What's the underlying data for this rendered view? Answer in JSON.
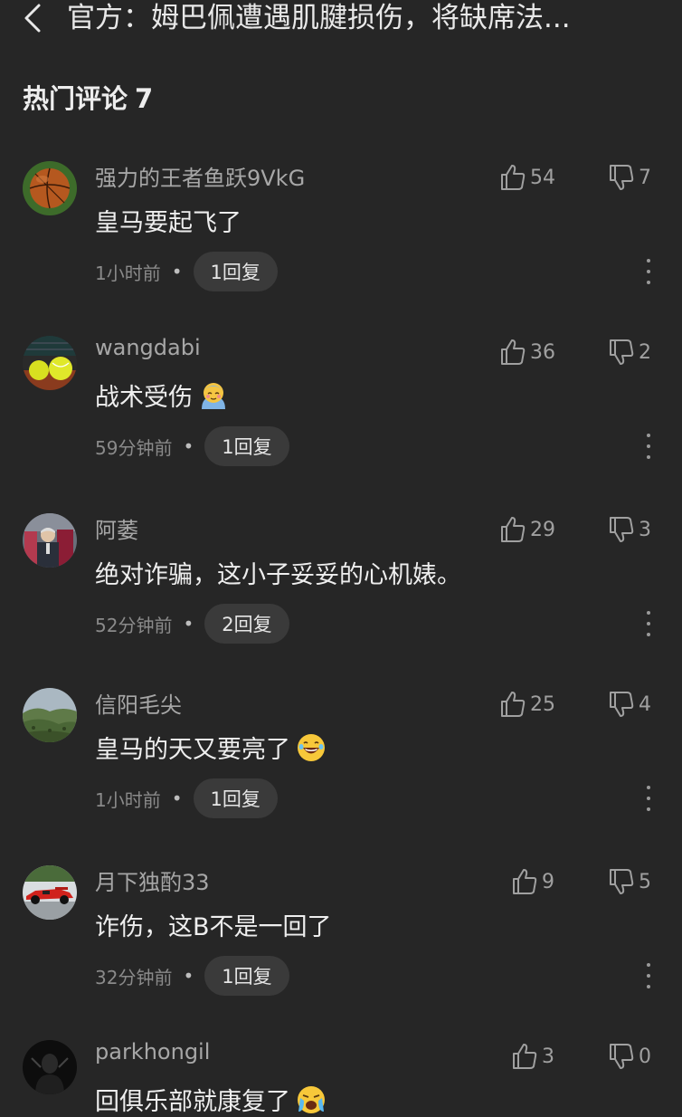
{
  "header": {
    "title": "官方：姆巴佩遭遇肌腱损伤，将缺席法..."
  },
  "section": {
    "title": "热门评论",
    "count": "7"
  },
  "comments": [
    {
      "user": "强力的王者鱼跃9VkG",
      "text": "皇马要起飞了",
      "likes": "54",
      "dislikes": "7",
      "time": "1小时前",
      "replies": "1回复",
      "avatar": "basketball-avatar"
    },
    {
      "user": "wangdabi",
      "text": "战术受伤",
      "likes": "36",
      "dislikes": "2",
      "time": "59分钟前",
      "replies": "1回复",
      "avatar": "tennis-balls-avatar",
      "emoji": "shy-face-emoji"
    },
    {
      "user": "阿萎",
      "text": "绝对诈骗，这小子妥妥的心机婊。",
      "likes": "29",
      "dislikes": "3",
      "time": "52分钟前",
      "replies": "2回复",
      "avatar": "coach-photo-avatar"
    },
    {
      "user": "信阳毛尖",
      "text": "皇马的天又要亮了",
      "likes": "25",
      "dislikes": "4",
      "time": "1小时前",
      "replies": "1回复",
      "avatar": "hills-landscape-avatar",
      "emoji": "laughing-face-emoji"
    },
    {
      "user": "月下独酌33",
      "text": "诈伤，这B不是一回了",
      "likes": "9",
      "dislikes": "5",
      "time": "32分钟前",
      "replies": "1回复",
      "avatar": "race-car-avatar"
    },
    {
      "user": "parkhongil",
      "text": "回俱乐部就康复了",
      "likes": "3",
      "dislikes": "0",
      "avatar": "dark-figure-avatar",
      "emoji": "crying-face-emoji"
    }
  ],
  "colors": {
    "background": "#262626",
    "text": "#eeeeee",
    "muted": "#a7a7a7",
    "chip": "#3a3a3a"
  }
}
